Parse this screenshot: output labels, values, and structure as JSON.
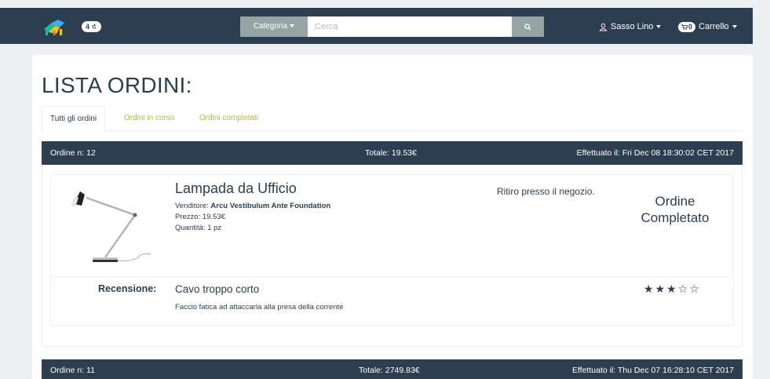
{
  "navbar": {
    "badge_count": "4",
    "category_label": "Categoria",
    "search_placeholder": "Cerca",
    "user_label": "Sasso Lino",
    "cart_count": "0",
    "cart_label": "Carrello"
  },
  "page": {
    "title": "LISTA ORDINI:",
    "tabs": [
      {
        "label": "Tutti gli ordini",
        "active": true
      },
      {
        "label": "Ordini in corso",
        "active": false
      },
      {
        "label": "Ordini completati",
        "active": false
      }
    ]
  },
  "orders": [
    {
      "number": "Ordine n: 12",
      "total": "Totale: 19.53€",
      "date": "Effettuato il: Fri Dec 08 18:30:02 CET 2017",
      "item": {
        "name": "Lampada da Ufficio",
        "seller_prefix": "Venditore: ",
        "seller": "Arcu Vestibulum Ante Foundation",
        "price": "Prezzo: 19.53€",
        "quantity": "Quantità: 1 pz",
        "delivery": "Ritiro presso il negozio.",
        "status": "Ordine Completato"
      },
      "review": {
        "label": "Recensione:",
        "title": "Cavo troppo corto",
        "text": "Faccio fatica ad attaccarla alla presa della corrente",
        "rating": 3,
        "max_rating": 5
      }
    },
    {
      "number": "Ordine n: 11",
      "total": "Totale: 2749.83€",
      "date": "Effettuato il: Thu Dec 07 16:28:10 CET 2017"
    }
  ],
  "colors": {
    "navbar": "#2c3e50",
    "accent": "#18bc9c",
    "tab_link": "#a5c13a",
    "background": "#ecf0f1"
  }
}
